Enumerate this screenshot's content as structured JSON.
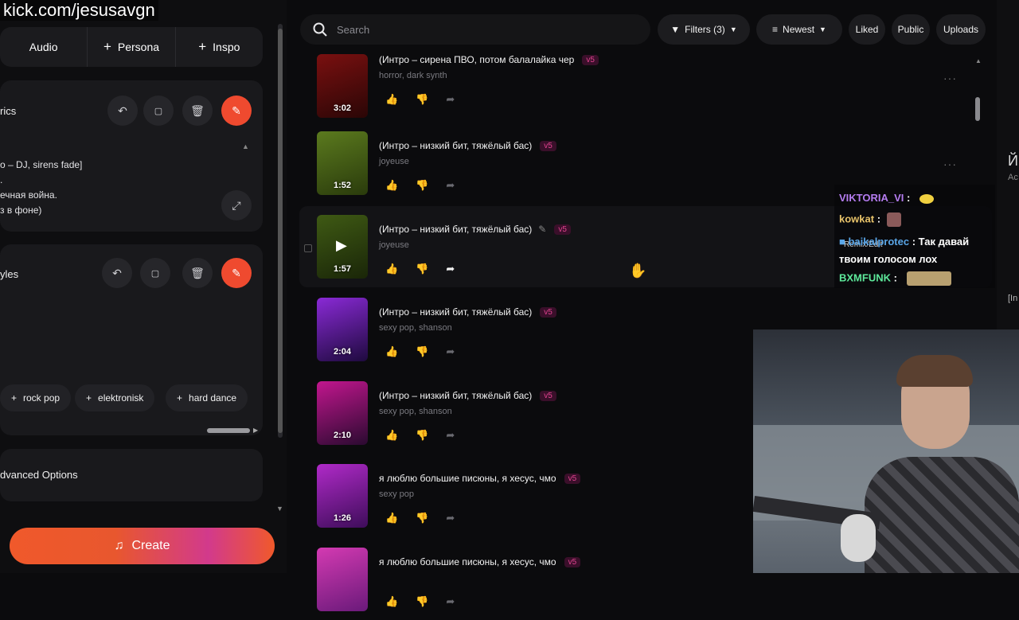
{
  "overlay_url": "kick.com/jesusavgn",
  "left": {
    "tabs": [
      "Audio",
      "Persona",
      "Inspo"
    ],
    "lyrics": {
      "title": "rics",
      "lines": [
        "o – DJ, sirens fade]",
        ".",
        "ечная война.",
        "з в фоне)"
      ]
    },
    "styles": {
      "title": "yles",
      "chips": [
        "rock pop",
        "elektronisk",
        "hard dance"
      ]
    },
    "advanced_label": "dvanced Options",
    "create_label": "Create"
  },
  "header": {
    "search_placeholder": "Search",
    "filters_label": "Filters (3)",
    "sort_label": "Newest",
    "liked_label": "Liked",
    "public_label": "Public",
    "uploads_label": "Uploads"
  },
  "songs": [
    {
      "title": "(Интро – сирена ПВО, потом балалайка чер",
      "tags": "horror, dark synth",
      "duration": "3:02",
      "badge": "v5",
      "colors": [
        "#7a1010",
        "#2a0606"
      ]
    },
    {
      "title": "(Интро – низкий бит, тяжёлый бас)",
      "tags": "joyeuse",
      "duration": "1:52",
      "badge": "v5",
      "colors": [
        "#5b7a1e",
        "#2a3b0c"
      ]
    },
    {
      "title": "(Интро – низкий бит, тяжёлый бас)",
      "tags": "joyeuse",
      "duration": "1:57",
      "badge": "v5",
      "colors": [
        "#3f5a14",
        "#1a2608"
      ]
    },
    {
      "title": "(Интро – низкий бит, тяжёлый бас)",
      "tags": "sexy pop, shanson",
      "duration": "2:04",
      "badge": "v5",
      "colors": [
        "#8a2ad6",
        "#1e0a3e"
      ]
    },
    {
      "title": "(Интро – низкий бит, тяжёлый бас)",
      "tags": "sexy pop, shanson",
      "duration": "2:10",
      "badge": "v5",
      "colors": [
        "#c2168e",
        "#2a0a30"
      ]
    },
    {
      "title": "я люблю большие писюны, я хесус, чмо",
      "tags": "sexy pop",
      "duration": "1:26",
      "badge": "v5",
      "colors": [
        "#b02ac8",
        "#3e0d5a"
      ]
    },
    {
      "title": "я люблю большие писюны, я хесус, чмо",
      "tags": "",
      "duration": "",
      "badge": "v5",
      "colors": [
        "#d43ab2",
        "#6a1a7a"
      ]
    }
  ],
  "remix_label": "Remix/Edit",
  "chat": [
    {
      "user": "VIKTORIA_VI",
      "text": "",
      "color": "#b57cf0"
    },
    {
      "user": "kowkat",
      "text": "",
      "color": "#e8c36a"
    },
    {
      "user": "baikalprotec",
      "text": "Так давай твоим голосом лох",
      "color": "#5aa6e8"
    },
    {
      "user": "BXMFUNK",
      "text": "",
      "color": "#5de89a"
    }
  ],
  "right_edge": {
    "char": "Й",
    "sub": "Ac",
    "mark": "[In"
  }
}
